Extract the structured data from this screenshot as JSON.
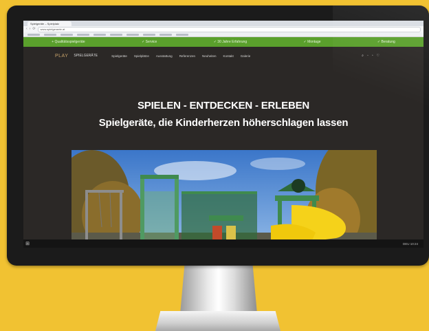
{
  "browser": {
    "tab_title": "Spielgeräte – Spielplatz",
    "url": "www.spielgeraete.at",
    "back": "‹",
    "forward": "›",
    "reload": "⟳"
  },
  "site": {
    "topbar": [
      "+ Qualitätsspielgeräte",
      "✓ Service",
      "✓ 30 Jahre Erfahrung",
      "✓ Montage",
      "✓ Beratung"
    ],
    "logo_text": "PLAY",
    "logo_tagline": "SPIELGERÄTE",
    "menu": [
      "Spielgeräte",
      "Spielplätze",
      "Ausstattung",
      "Referenzen",
      "Neuheiten",
      "Kontakt",
      "Galerie"
    ],
    "header_icons": [
      "search-icon",
      "user-icon",
      "cart-icon",
      "heart-icon"
    ],
    "hero_title": "SPIELEN - ENTDECKEN - ERLEBEN",
    "hero_subtitle": "Spielgeräte, die Kinderherzen höherschlagen lassen"
  },
  "taskbar": {
    "start": "⊞",
    "tray_text": "DEU  10:24"
  },
  "colors": {
    "background": "#f1c232",
    "green_bar": "#5aa02c",
    "site_bg": "#2b2826",
    "slide_yellow": "#f5d21a",
    "frame_green": "#3f8a4e"
  }
}
